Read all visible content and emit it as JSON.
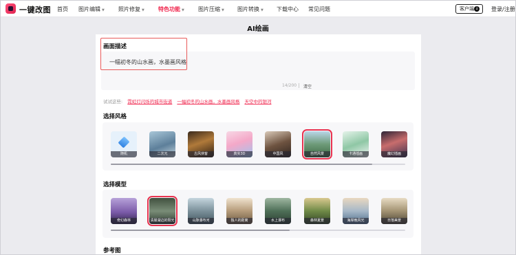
{
  "app": {
    "logo_text": "一键改图",
    "brand_color": "#f0284f"
  },
  "nav": {
    "items": [
      {
        "label": "首页",
        "dropdown": false,
        "active": false
      },
      {
        "label": "图片编辑",
        "dropdown": true,
        "active": false
      },
      {
        "label": "照片修复",
        "dropdown": true,
        "active": false
      },
      {
        "label": "特色功能",
        "dropdown": true,
        "active": true
      },
      {
        "label": "图片压缩",
        "dropdown": true,
        "active": false
      },
      {
        "label": "图片转换",
        "dropdown": true,
        "active": false
      },
      {
        "label": "下载中心",
        "dropdown": false,
        "active": false
      },
      {
        "label": "常见问题",
        "dropdown": false,
        "active": false
      }
    ],
    "client_label": "客户端",
    "login_label": "登录/注册"
  },
  "page": {
    "title": "AI绘画"
  },
  "description": {
    "section_title": "画面描述",
    "text": "一幅初冬的山水画，水墨画风格",
    "counter": "14/200",
    "clear_label": "清空",
    "try_label": "试试这些:",
    "examples": [
      "霓虹灯闪烁的城市街道",
      "一幅初冬的山水画，水墨画风格",
      "天空中的银河"
    ]
  },
  "style_section": {
    "title": "选择风格",
    "items": [
      {
        "label": "随机",
        "icon": "diamond-icon",
        "selected": false
      },
      {
        "label": "二次元",
        "selected": false
      },
      {
        "label": "古风侠客",
        "selected": false
      },
      {
        "label": "真实3D",
        "selected": false
      },
      {
        "label": "中国风",
        "selected": false
      },
      {
        "label": "自然风景",
        "selected": true
      },
      {
        "label": "卡通插画",
        "selected": false
      },
      {
        "label": "魔幻插画",
        "selected": false
      }
    ]
  },
  "model_section": {
    "title": "选择模型",
    "items": [
      {
        "label": "奇幻森林",
        "selected": false
      },
      {
        "label": "清晨湖边的阳光",
        "selected": true
      },
      {
        "label": "山脉瀑布河",
        "selected": false
      },
      {
        "label": "独人的距离",
        "selected": false
      },
      {
        "label": "水上瀑布",
        "selected": false
      },
      {
        "label": "森林夏景",
        "selected": false
      },
      {
        "label": "海岸晚风光",
        "selected": false
      },
      {
        "label": "日落美景",
        "selected": false
      }
    ]
  },
  "reference_section": {
    "title": "参考图"
  }
}
